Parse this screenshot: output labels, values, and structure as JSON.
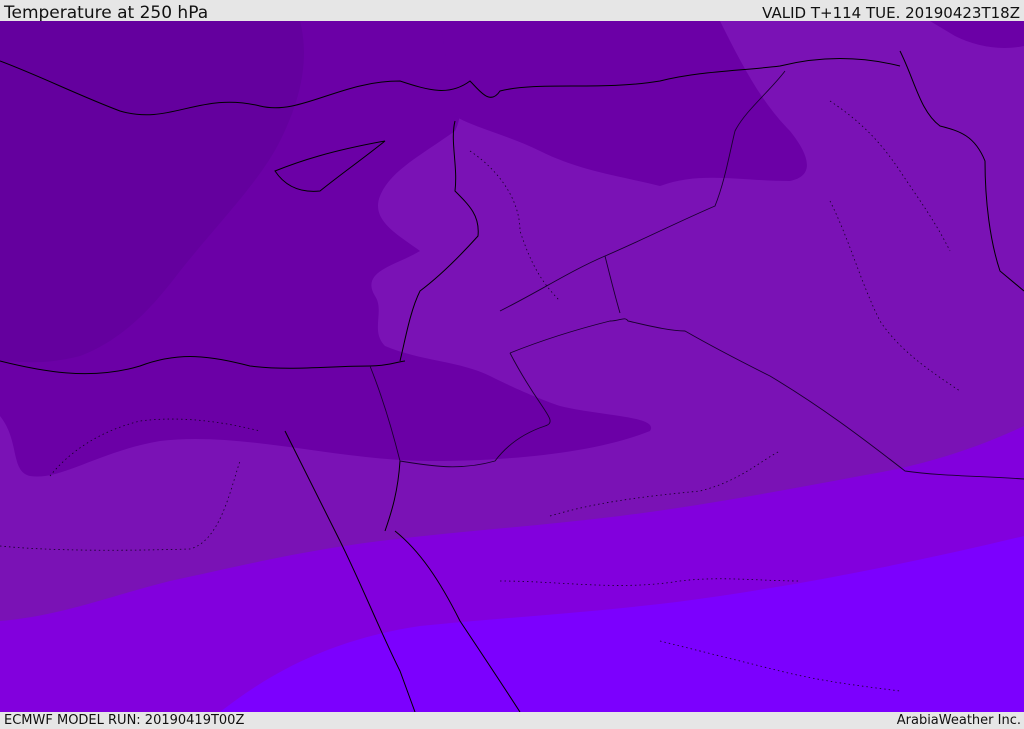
{
  "header": {
    "title": "Temperature at 250 hPa",
    "valid_time": "VALID T+114 TUE. 20190423T18Z"
  },
  "footer": {
    "model_run": "ECMWF MODEL RUN: 20190419T00Z",
    "credit": "ArabiaWeather Inc."
  },
  "map": {
    "colors": {
      "band_coldest": "#5f0097",
      "band_cold": "#6b00a6",
      "band_mid": "#7a12b5",
      "band_warm": "#8200dd",
      "band_warmest": "#7c00fe",
      "coastline": "#000000",
      "border": "#1a0030"
    }
  }
}
